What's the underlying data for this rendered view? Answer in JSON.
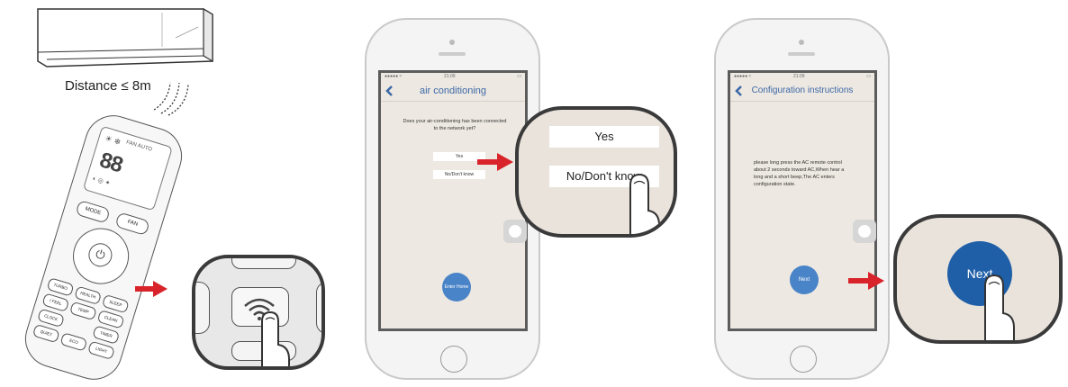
{
  "step1": {
    "distance_label": "Distance ≤ 8m",
    "remote_buttons": {
      "mode": "MODE",
      "fan": "FAN",
      "turbo": "TURBO",
      "health": "HEALTH",
      "sleep": "SLEEP",
      "i_feel": "I FEEL",
      "temp": "TEMP",
      "clean": "CLEAN",
      "clock": "CLOCK",
      "quiet": "QUIET",
      "eco": "ECO",
      "light": "LIGHT",
      "timer": "TIMER"
    }
  },
  "step2": {
    "status_time": "21:09",
    "title": "air conditioning",
    "question": "Does your air-conditioning has been connected to the network yet?",
    "options": [
      "Yes",
      "No/Don't know"
    ],
    "enter_home_label": "Enter Home",
    "zoom_options": [
      "Yes",
      "No/Don't know"
    ]
  },
  "step3": {
    "status_time": "21:09",
    "title": "Configuration instructions",
    "instruction": "please long press the AC remote control about 2 seconds toward AC,When hear a long and a short beep,The AC enters configuration state.",
    "next_label": "Next",
    "zoom_next_label": "Next"
  },
  "colors": {
    "accent_blue": "#3c68a8",
    "button_blue": "#4a84c8",
    "arrow_red": "#d8232a",
    "lens_border": "#3a3a3a"
  },
  "icons": [
    "air-conditioner-icon",
    "signal-waves-icon",
    "remote-control-icon",
    "arrow-right-icon",
    "back-chevron-icon",
    "home-button-icon",
    "finger-icon",
    "wifi-icon"
  ]
}
